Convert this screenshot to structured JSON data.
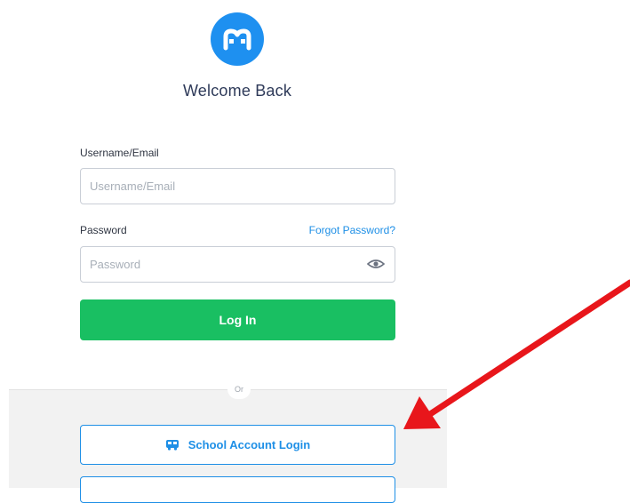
{
  "brand": {
    "accent": "#1e90f0",
    "green": "#19bf62",
    "link": "#1e8fe6",
    "arrow": "#e8161b",
    "logo_icon": "m-logo-icon"
  },
  "header": {
    "title": "Welcome Back"
  },
  "form": {
    "username_label": "Username/Email",
    "username_placeholder": "Username/Email",
    "password_label": "Password",
    "forgot_label": "Forgot Password?",
    "password_placeholder": "Password",
    "eye_icon": "eye-icon",
    "login_label": "Log In"
  },
  "alternatives": {
    "or_label": "Or",
    "school_label": "School Account Login",
    "school_icon": "bus-icon"
  }
}
